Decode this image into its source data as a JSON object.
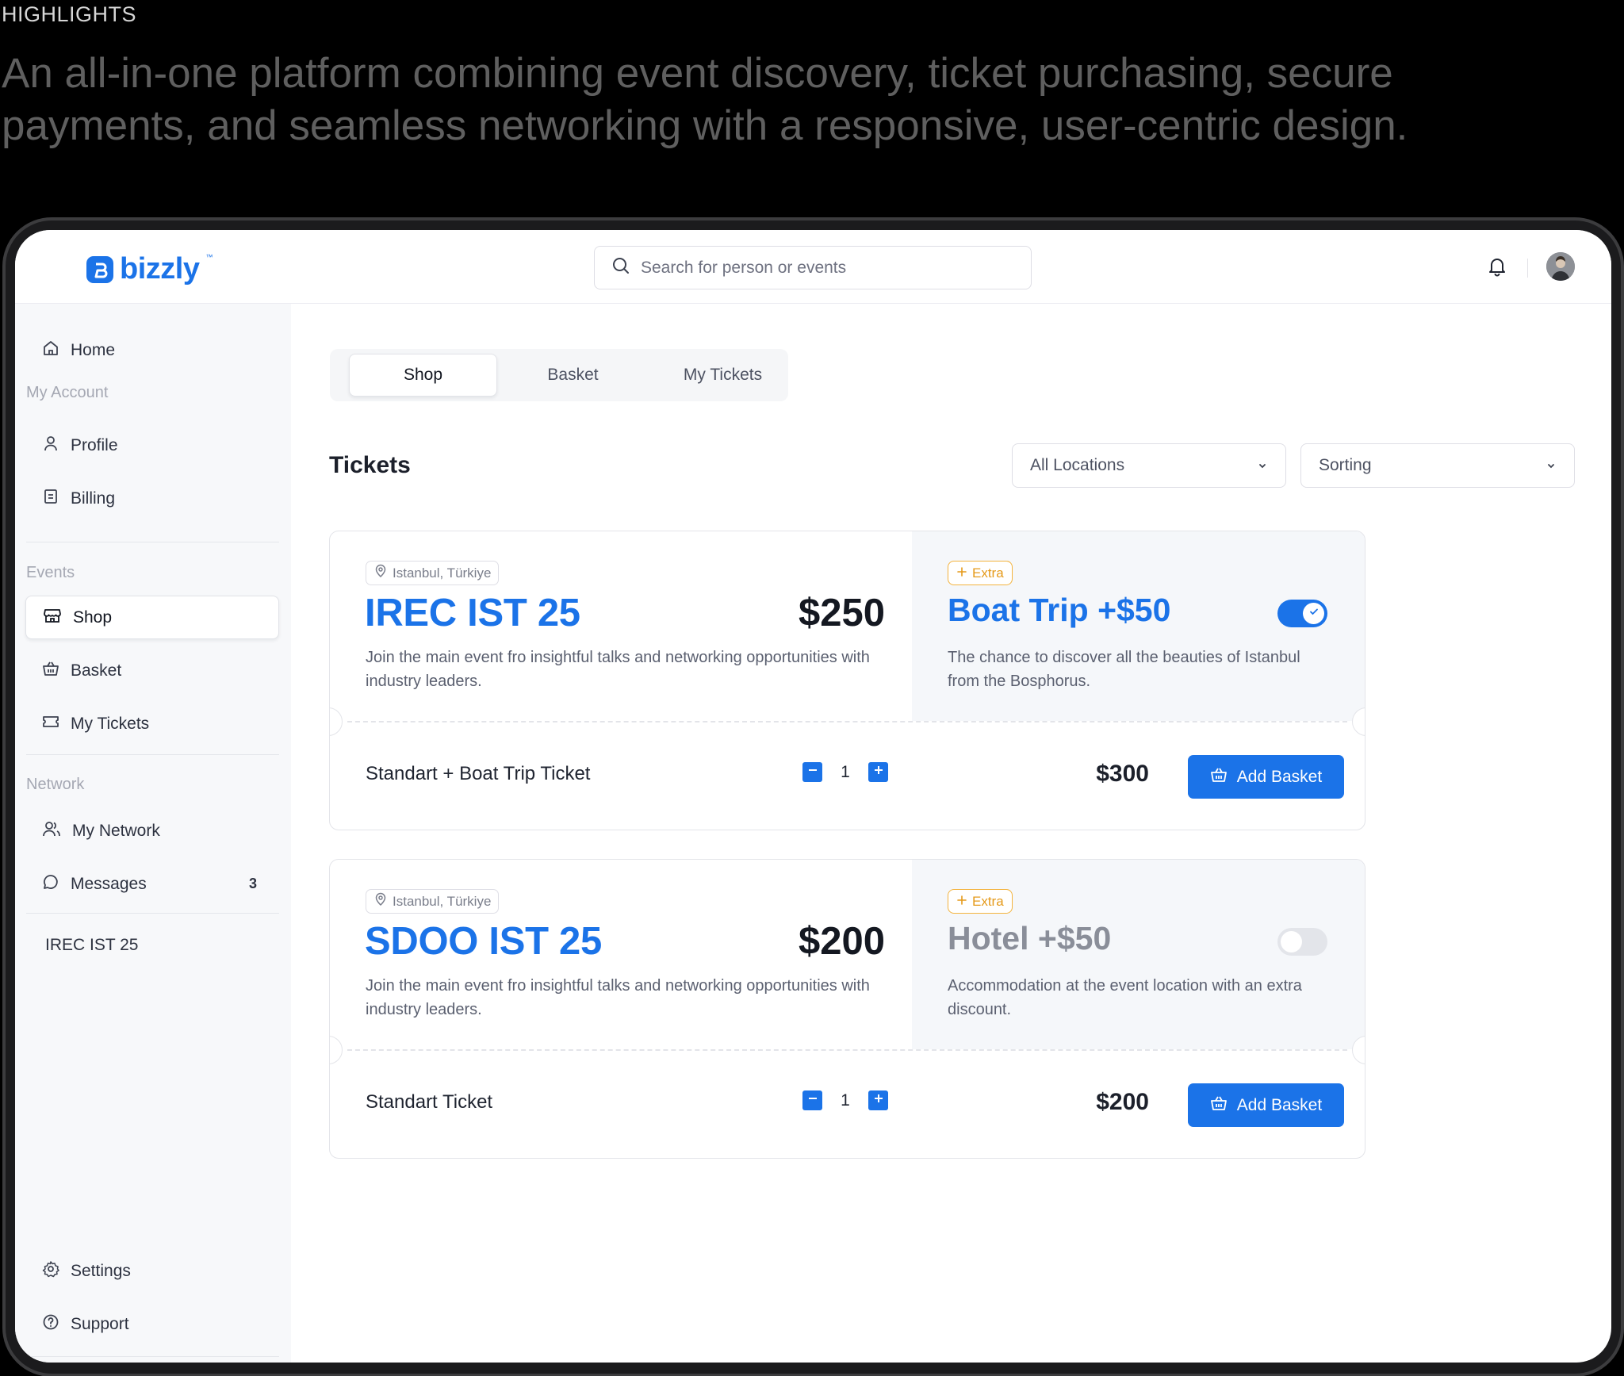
{
  "highlights": {
    "label": "HIGHLIGHTS",
    "text": "An all-in-one platform combining event discovery, ticket purchasing, secure payments, and seamless networking with a responsive, user-centric design."
  },
  "brand": {
    "name": "bizzly",
    "tm": "™",
    "accent": "#1b73e8"
  },
  "search": {
    "placeholder": "Search for person or events"
  },
  "sidebar": {
    "home": "Home",
    "my_account_heading": "My Account",
    "profile": "Profile",
    "billing": "Billing",
    "events_heading": "Events",
    "shop": "Shop",
    "basket": "Basket",
    "my_tickets": "My Tickets",
    "network_heading": "Network",
    "my_network": "My Network",
    "messages": "Messages",
    "messages_count": "3",
    "event_link": "IREC IST 25",
    "settings": "Settings",
    "support": "Support"
  },
  "tabs": {
    "shop": "Shop",
    "basket": "Basket",
    "my_tickets": "My Tickets",
    "active": "Shop"
  },
  "main": {
    "title": "Tickets",
    "location_select": "All Locations",
    "sorting_select": "Sorting"
  },
  "tickets": [
    {
      "location": "Istanbul, Türkiye",
      "title": "IREC IST 25",
      "price": "$250",
      "description": "Join the main event fro insightful talks and networking opportunities with industry leaders.",
      "extra_label": "Extra",
      "extra_title": "Boat Trip +$50",
      "extra_description": "The chance to discover all the beauties of Istanbul from the Bosphorus.",
      "extra_enabled": true,
      "ticket_name": "Standart + Boat Trip Ticket",
      "quantity": "1",
      "total": "$300",
      "button": "Add Basket"
    },
    {
      "location": "Istanbul, Türkiye",
      "title": "SDOO IST 25",
      "price": "$200",
      "description": "Join the main event fro insightful talks and networking opportunities with industry leaders.",
      "extra_label": "Extra",
      "extra_title": "Hotel +$50",
      "extra_description": "Accommodation at the event location with an extra discount.",
      "extra_enabled": false,
      "ticket_name": "Standart Ticket",
      "quantity": "1",
      "total": "$200",
      "button": "Add Basket"
    }
  ]
}
